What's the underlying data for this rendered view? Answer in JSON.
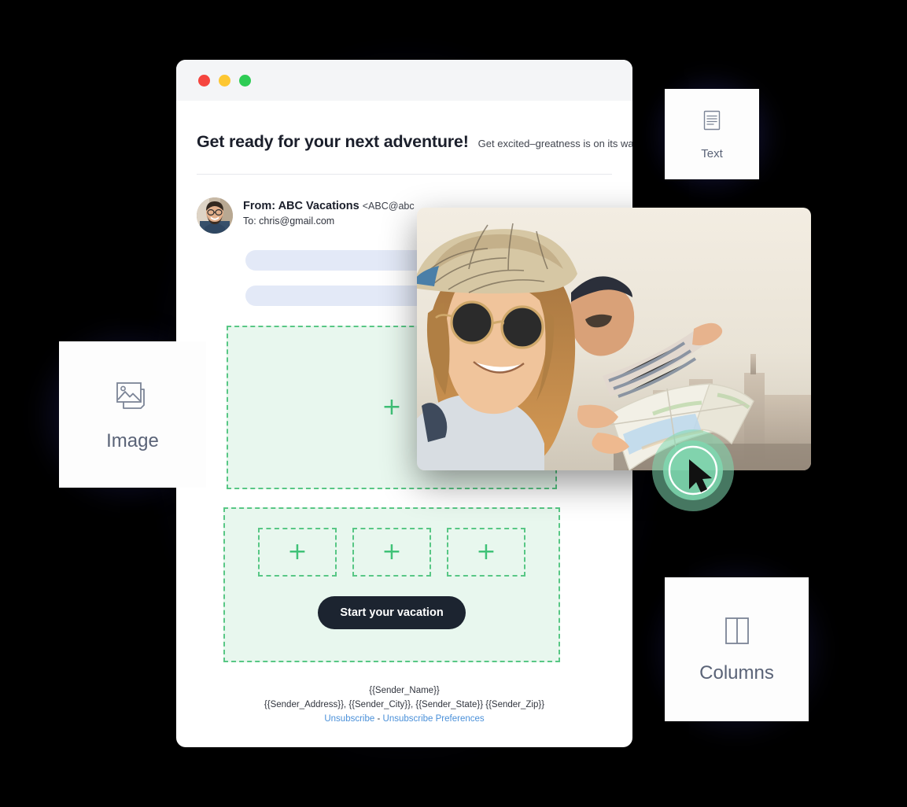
{
  "window": {
    "traffic_lights": [
      {
        "name": "close",
        "color": "#f5453f"
      },
      {
        "name": "minimize",
        "color": "#fdc732"
      },
      {
        "name": "zoom",
        "color": "#2ecc55"
      }
    ]
  },
  "email": {
    "headline": "Get ready for your next adventure!",
    "subheadline": "Get excited–greatness is on its way.",
    "sender": {
      "from_label": "From: ABC Vacations",
      "from_address": "<ABC@abc",
      "to_line": "To: chris@gmail.com"
    },
    "cta_label": "Start your vacation",
    "footer": {
      "sender_name": "{{Sender_Name}}",
      "sender_address": "{{Sender_Address}}, {{Sender_City}}, {{Sender_State}} {{Sender_Zip}}",
      "unsubscribe": "Unsubscribe",
      "separator": "-",
      "unsubscribe_preferences": "Unsubscribe Preferences"
    }
  },
  "dropzones": {
    "plus_glyph": "+",
    "fill_color": "#e8f7ee",
    "border_color": "#58c785",
    "plus_color": "#3fc277"
  },
  "widgets": [
    {
      "label": "Text",
      "icon": "text-block-icon"
    },
    {
      "label": "Image",
      "icon": "image-block-icon"
    },
    {
      "label": "Columns",
      "icon": "columns-block-icon"
    }
  ],
  "colors": {
    "accent_green": "#58c785",
    "cta_background": "#1c2430",
    "link_blue": "#4a90d9",
    "skeleton_bar": "#e3e9f7",
    "glow": "#2e2e78"
  }
}
